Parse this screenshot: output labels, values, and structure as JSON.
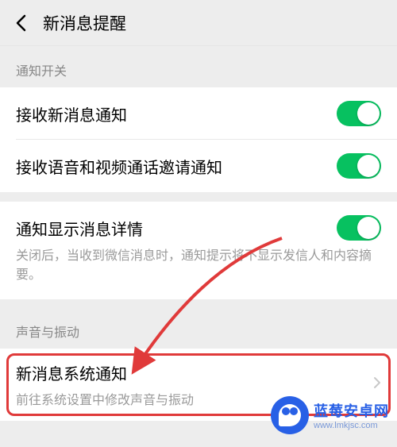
{
  "header": {
    "title": "新消息提醒"
  },
  "sections": {
    "switch_label": "通知开关",
    "sound_label": "声音与振动"
  },
  "rows": {
    "receive_new": "接收新消息通知",
    "receive_call": "接收语音和视频通话邀请通知",
    "show_detail": "通知显示消息详情",
    "show_detail_desc": "关闭后，当收到微信消息时，通知提示将不显示发信人和内容摘要。",
    "system_notify_title": "新消息系统通知",
    "system_notify_sub": "前往系统设置中修改声音与振动"
  },
  "watermark": {
    "brand": "蓝莓安卓网",
    "url": "www.lmkjsc.com"
  },
  "toggles": {
    "receive_new": true,
    "receive_call": true,
    "show_detail": true
  }
}
